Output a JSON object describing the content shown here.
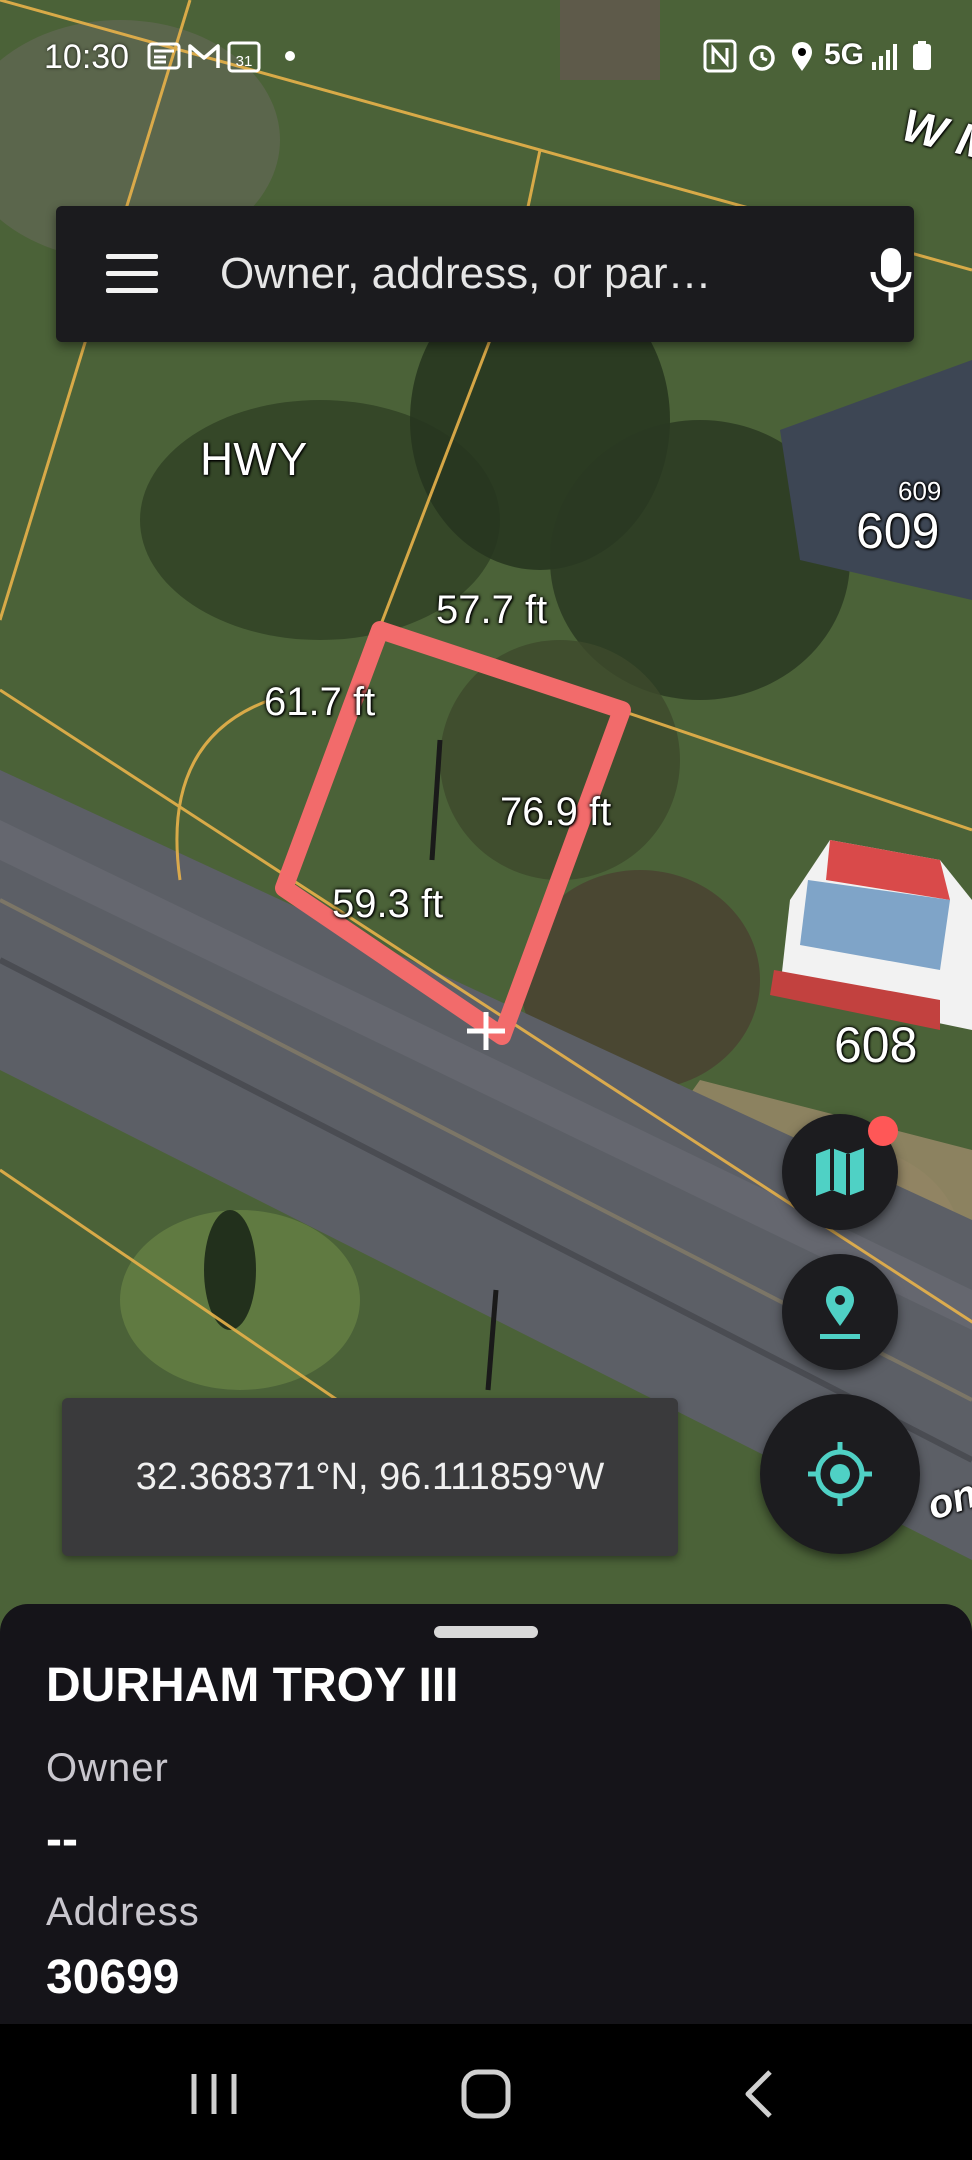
{
  "status_bar": {
    "time": "10:30",
    "calendar_day": "31",
    "network": "5G"
  },
  "search": {
    "placeholder": "Owner, address, or par…"
  },
  "map": {
    "road_label": "HWY",
    "street_label_top": "W M",
    "street_label_bottom": "on",
    "parcel_numbers": [
      "609",
      "609",
      "608"
    ],
    "dimensions": {
      "top": "57.7 ft",
      "left": "61.7 ft",
      "right": "76.9 ft",
      "bottom": "59.3 ft"
    },
    "parcel_outline_color": "#f26b6b",
    "lot_line_color": "#e8b24a"
  },
  "coordinates": "32.368371°N, 96.111859°W",
  "parcel": {
    "owner_value": "DURHAM TROY III",
    "owner_label": "Owner",
    "address_value": "--",
    "address_label": "Address",
    "parcel_id": "30699"
  },
  "colors": {
    "accent": "#4fd1c5",
    "badge": "#ff5757",
    "sheet_background": "#151419"
  },
  "icons": {
    "menu": "hamburger-menu-icon",
    "mic": "microphone-icon",
    "layers": "map-layers-icon",
    "pin": "drop-pin-icon",
    "locate": "my-location-icon",
    "crosshair": "crosshair-icon"
  }
}
